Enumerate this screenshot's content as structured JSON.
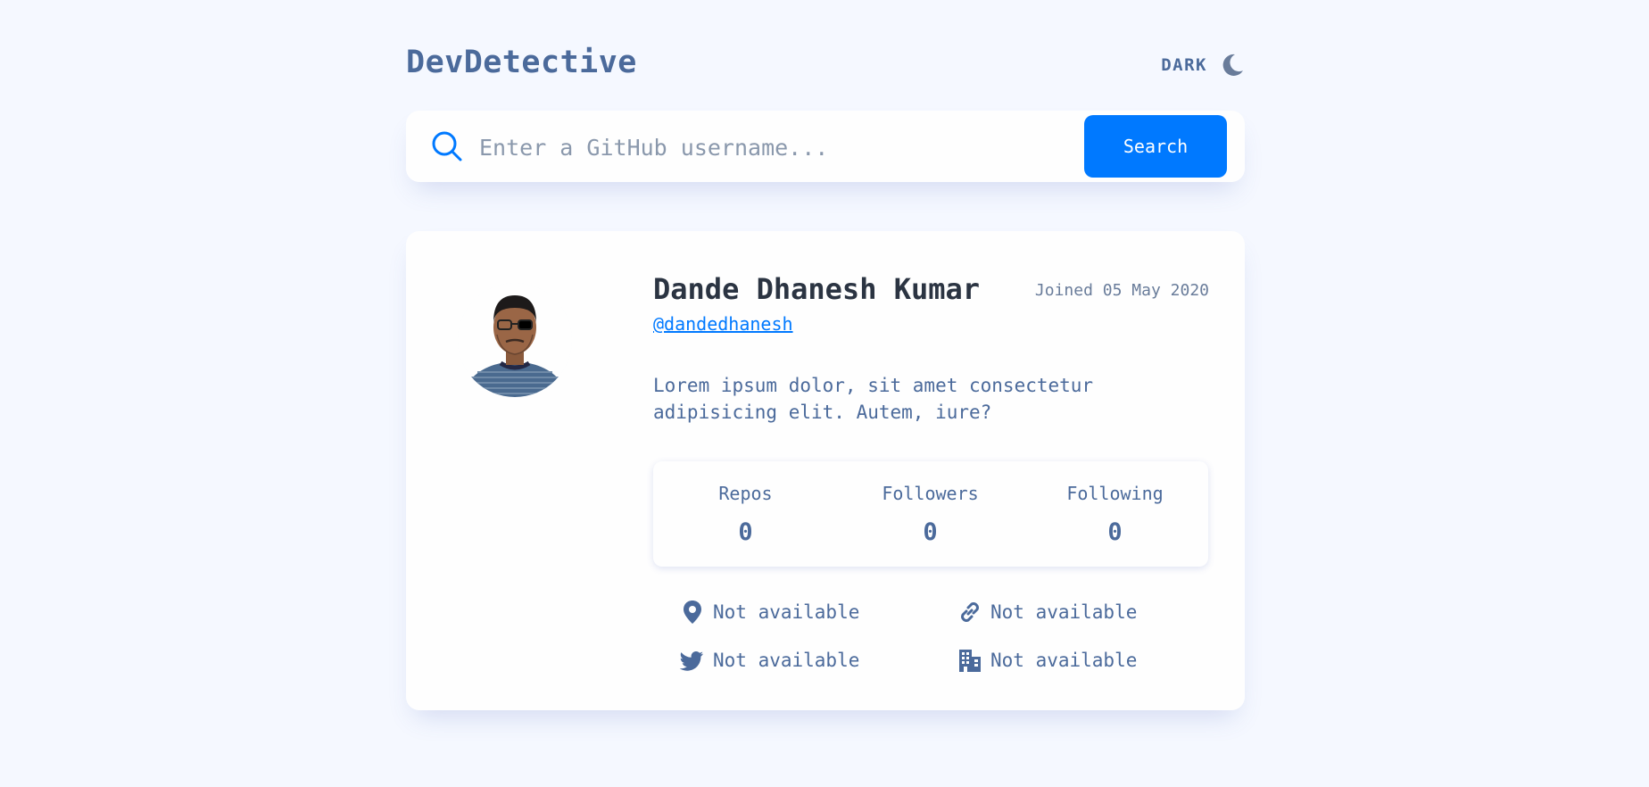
{
  "header": {
    "logo": "DevDetective",
    "mode_label": "DARK",
    "mode_icon": "moon-icon"
  },
  "search": {
    "placeholder": "Enter a GitHub username...",
    "value": "",
    "button_label": "Search",
    "icon": "search-icon"
  },
  "profile": {
    "name": "Dande Dhanesh Kumar",
    "joined": "Joined 05 May 2020",
    "handle": "@dandedhanesh",
    "bio": "Lorem ipsum dolor, sit amet consectetur adipisicing elit. Autem, iure?",
    "avatar": "profile-photo"
  },
  "stats": [
    {
      "label": "Repos",
      "value": "0"
    },
    {
      "label": "Followers",
      "value": "0"
    },
    {
      "label": "Following",
      "value": "0"
    }
  ],
  "info": {
    "location": {
      "icon": "location-pin-icon",
      "text": "Not available"
    },
    "website": {
      "icon": "link-icon",
      "text": "Not available"
    },
    "twitter": {
      "icon": "twitter-icon",
      "text": "Not available"
    },
    "company": {
      "icon": "building-icon",
      "text": "Not available"
    }
  },
  "colors": {
    "background": "#f5f8ff",
    "card": "#fefefe",
    "accent": "#0079ff",
    "text": "#4b6a9b",
    "heading": "#2b3442"
  }
}
